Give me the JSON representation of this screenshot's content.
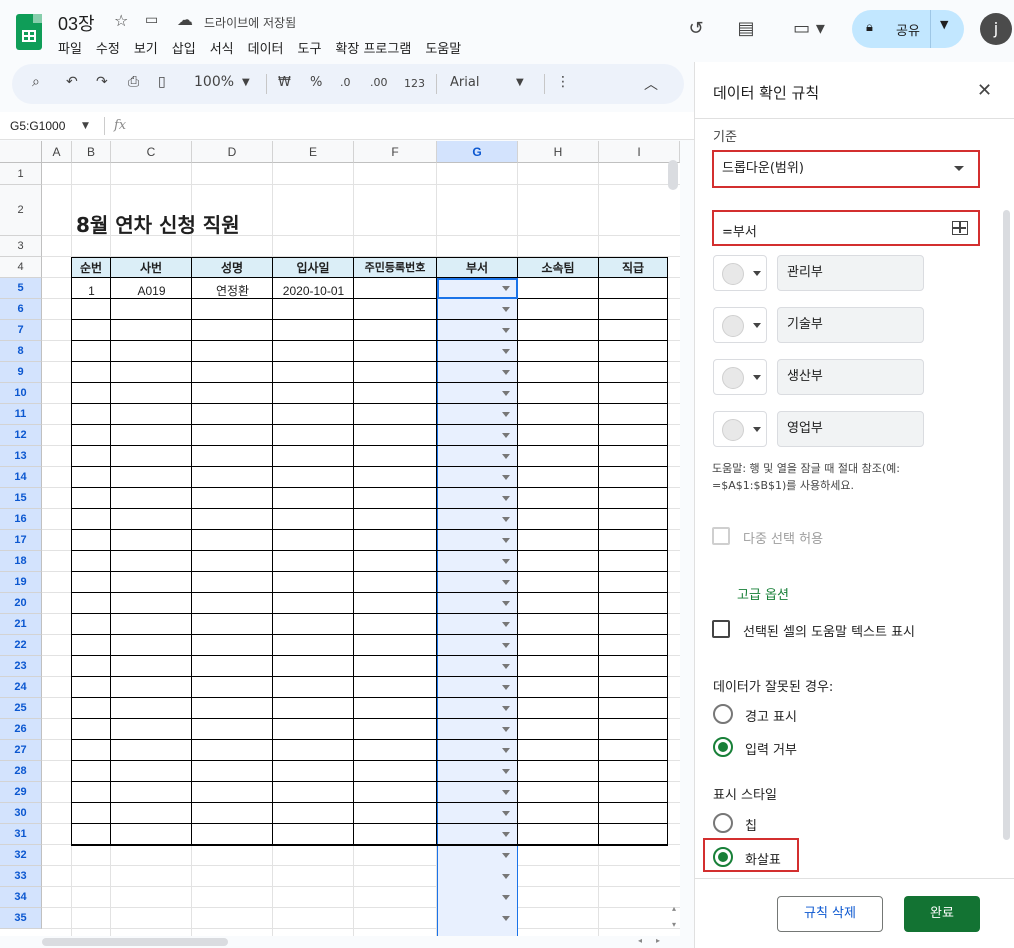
{
  "header": {
    "title": "03장",
    "star_icon": "star-icon",
    "move_icon": "folder-move-icon",
    "cloud_icon": "cloud-done-icon",
    "saved_status": "드라이브에 저장됨",
    "menu": [
      "파일",
      "수정",
      "보기",
      "삽입",
      "서식",
      "데이터",
      "도구",
      "확장 프로그램",
      "도움말"
    ],
    "share_label": "공유",
    "avatar_letter": "j"
  },
  "toolbar": {
    "zoom": "100%",
    "currency": "₩",
    "percent": "%",
    "dec_decrease": ".0",
    "dec_increase": ".00",
    "number_format": "123",
    "font": "Arial"
  },
  "formula_bar": {
    "name_box": "G5:G1000",
    "fx": "fx"
  },
  "grid": {
    "columns": [
      "A",
      "B",
      "C",
      "D",
      "E",
      "F",
      "G",
      "H",
      "I"
    ],
    "rows": [
      "1",
      "2",
      "3",
      "4",
      "5",
      "6",
      "7",
      "8",
      "9",
      "10",
      "11",
      "12",
      "13",
      "14",
      "15",
      "16",
      "17",
      "18",
      "19",
      "20",
      "21",
      "22",
      "23",
      "24",
      "25",
      "26",
      "27",
      "28",
      "29",
      "30",
      "31",
      "32",
      "33",
      "34",
      "35"
    ],
    "sheet_title": "8월 연차 신청 직원",
    "table_headers": [
      "순번",
      "사번",
      "성명",
      "입사일",
      "주민등록번호",
      "부서",
      "소속팀",
      "직급"
    ],
    "first_row": [
      "1",
      "A019",
      "연정환",
      "2020-10-01",
      "",
      "",
      "",
      ""
    ]
  },
  "panel": {
    "title": "데이터 확인 규칙",
    "criteria_label": "기준",
    "criteria_value": "드롭다운(범위)",
    "range_value": "=부서",
    "items": [
      "관리부",
      "기술부",
      "생산부",
      "영업부"
    ],
    "help_line1": "도움말: 행 및 열을 잠글 때 절대 참조(예:",
    "help_line2": "=$A$1:$B$1)를 사용하세요.",
    "multi_select": "다중 선택 허용",
    "advanced": "고급 옵션",
    "show_help": "선택된 셀의 도움말 텍스트 표시",
    "invalid_label": "데이터가 잘못된 경우:",
    "warn": "경고 표시",
    "reject": "입력 거부",
    "style_label": "표시 스타일",
    "chip": "칩",
    "arrow": "화살표",
    "delete_button": "규칙 삭제",
    "done_button": "완료"
  }
}
